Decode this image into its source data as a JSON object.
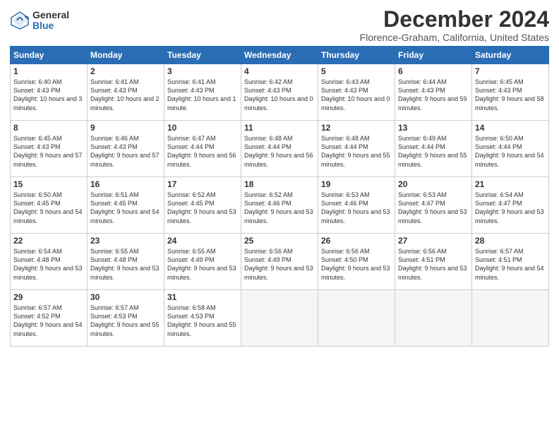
{
  "logo": {
    "general": "General",
    "blue": "Blue"
  },
  "title": "December 2024",
  "location": "Florence-Graham, California, United States",
  "days_of_week": [
    "Sunday",
    "Monday",
    "Tuesday",
    "Wednesday",
    "Thursday",
    "Friday",
    "Saturday"
  ],
  "weeks": [
    [
      {
        "day": 1,
        "sunrise": "6:40 AM",
        "sunset": "4:43 PM",
        "daylight": "10 hours and 3 minutes."
      },
      {
        "day": 2,
        "sunrise": "6:41 AM",
        "sunset": "4:43 PM",
        "daylight": "10 hours and 2 minutes."
      },
      {
        "day": 3,
        "sunrise": "6:41 AM",
        "sunset": "4:43 PM",
        "daylight": "10 hours and 1 minute."
      },
      {
        "day": 4,
        "sunrise": "6:42 AM",
        "sunset": "4:43 PM",
        "daylight": "10 hours and 0 minutes."
      },
      {
        "day": 5,
        "sunrise": "6:43 AM",
        "sunset": "4:43 PM",
        "daylight": "10 hours and 0 minutes."
      },
      {
        "day": 6,
        "sunrise": "6:44 AM",
        "sunset": "4:43 PM",
        "daylight": "9 hours and 59 minutes."
      },
      {
        "day": 7,
        "sunrise": "6:45 AM",
        "sunset": "4:43 PM",
        "daylight": "9 hours and 58 minutes."
      }
    ],
    [
      {
        "day": 8,
        "sunrise": "6:45 AM",
        "sunset": "4:43 PM",
        "daylight": "9 hours and 57 minutes."
      },
      {
        "day": 9,
        "sunrise": "6:46 AM",
        "sunset": "4:43 PM",
        "daylight": "9 hours and 57 minutes."
      },
      {
        "day": 10,
        "sunrise": "6:47 AM",
        "sunset": "4:44 PM",
        "daylight": "9 hours and 56 minutes."
      },
      {
        "day": 11,
        "sunrise": "6:48 AM",
        "sunset": "4:44 PM",
        "daylight": "9 hours and 56 minutes."
      },
      {
        "day": 12,
        "sunrise": "6:48 AM",
        "sunset": "4:44 PM",
        "daylight": "9 hours and 55 minutes."
      },
      {
        "day": 13,
        "sunrise": "6:49 AM",
        "sunset": "4:44 PM",
        "daylight": "9 hours and 55 minutes."
      },
      {
        "day": 14,
        "sunrise": "6:50 AM",
        "sunset": "4:44 PM",
        "daylight": "9 hours and 54 minutes."
      }
    ],
    [
      {
        "day": 15,
        "sunrise": "6:50 AM",
        "sunset": "4:45 PM",
        "daylight": "9 hours and 54 minutes."
      },
      {
        "day": 16,
        "sunrise": "6:51 AM",
        "sunset": "4:45 PM",
        "daylight": "9 hours and 54 minutes."
      },
      {
        "day": 17,
        "sunrise": "6:52 AM",
        "sunset": "4:45 PM",
        "daylight": "9 hours and 53 minutes."
      },
      {
        "day": 18,
        "sunrise": "6:52 AM",
        "sunset": "4:46 PM",
        "daylight": "9 hours and 53 minutes."
      },
      {
        "day": 19,
        "sunrise": "6:53 AM",
        "sunset": "4:46 PM",
        "daylight": "9 hours and 53 minutes."
      },
      {
        "day": 20,
        "sunrise": "6:53 AM",
        "sunset": "4:47 PM",
        "daylight": "9 hours and 53 minutes."
      },
      {
        "day": 21,
        "sunrise": "6:54 AM",
        "sunset": "4:47 PM",
        "daylight": "9 hours and 53 minutes."
      }
    ],
    [
      {
        "day": 22,
        "sunrise": "6:54 AM",
        "sunset": "4:48 PM",
        "daylight": "9 hours and 53 minutes."
      },
      {
        "day": 23,
        "sunrise": "6:55 AM",
        "sunset": "4:48 PM",
        "daylight": "9 hours and 53 minutes."
      },
      {
        "day": 24,
        "sunrise": "6:55 AM",
        "sunset": "4:49 PM",
        "daylight": "9 hours and 53 minutes."
      },
      {
        "day": 25,
        "sunrise": "6:56 AM",
        "sunset": "4:49 PM",
        "daylight": "9 hours and 53 minutes."
      },
      {
        "day": 26,
        "sunrise": "6:56 AM",
        "sunset": "4:50 PM",
        "daylight": "9 hours and 53 minutes."
      },
      {
        "day": 27,
        "sunrise": "6:56 AM",
        "sunset": "4:51 PM",
        "daylight": "9 hours and 53 minutes."
      },
      {
        "day": 28,
        "sunrise": "6:57 AM",
        "sunset": "4:51 PM",
        "daylight": "9 hours and 54 minutes."
      }
    ],
    [
      {
        "day": 29,
        "sunrise": "6:57 AM",
        "sunset": "4:52 PM",
        "daylight": "9 hours and 54 minutes."
      },
      {
        "day": 30,
        "sunrise": "6:57 AM",
        "sunset": "4:53 PM",
        "daylight": "9 hours and 55 minutes."
      },
      {
        "day": 31,
        "sunrise": "6:58 AM",
        "sunset": "4:53 PM",
        "daylight": "9 hours and 55 minutes."
      },
      null,
      null,
      null,
      null
    ]
  ]
}
